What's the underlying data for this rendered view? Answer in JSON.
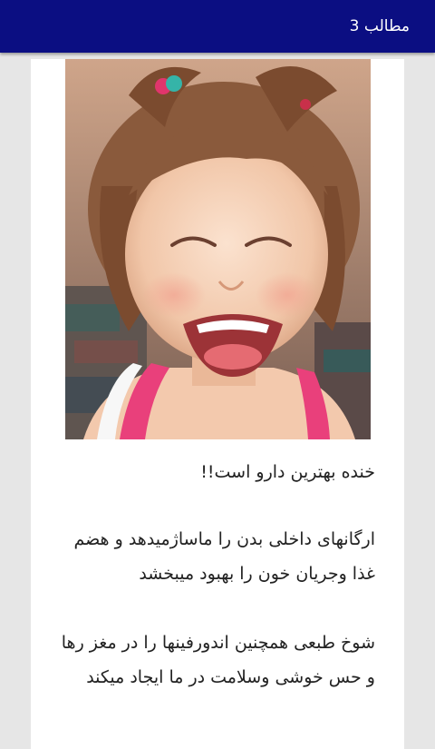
{
  "appbar": {
    "title": "مطالب 3",
    "color": "#0b0e82"
  },
  "image": {
    "alt": "تصویر کودک خندان"
  },
  "article": {
    "title": "خنده بهترین دارو است!!",
    "paragraph1": "ارگانهای داخلی بدن را ماساژمیدهد و هضم غذا وجریان خون را بهبود میبخشد",
    "paragraph2": "شوخ طبعی همچنین اندورفینها را در مغز رها و حس خوشی وسلامت در ما ایجاد میکند"
  }
}
